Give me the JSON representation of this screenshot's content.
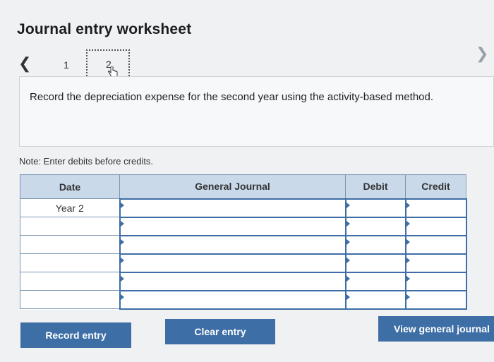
{
  "page": {
    "title": "Journal entry worksheet",
    "prev_icon": "chevron-left-icon",
    "next_icon": "chevron-right-icon",
    "steps": [
      "1",
      "2"
    ],
    "active_step": "2",
    "pointer_icon": "hand-pointer-icon"
  },
  "prompt": {
    "text": "Record the depreciation expense for the second year using the activity-based method."
  },
  "note": "Note: Enter debits before credits.",
  "table": {
    "headers": {
      "date": "Date",
      "general_journal": "General Journal",
      "debit": "Debit",
      "credit": "Credit"
    },
    "rows": [
      {
        "date": "Year 2",
        "account": "",
        "debit": "",
        "credit": ""
      },
      {
        "date": "",
        "account": "",
        "debit": "",
        "credit": ""
      },
      {
        "date": "",
        "account": "",
        "debit": "",
        "credit": ""
      },
      {
        "date": "",
        "account": "",
        "debit": "",
        "credit": ""
      },
      {
        "date": "",
        "account": "",
        "debit": "",
        "credit": ""
      },
      {
        "date": "",
        "account": "",
        "debit": "",
        "credit": ""
      }
    ]
  },
  "buttons": {
    "record": "Record entry",
    "clear": "Clear entry",
    "view": "View general journal"
  },
  "colors": {
    "accent": "#3d6ea5",
    "header_bg": "#c9d9ea"
  }
}
